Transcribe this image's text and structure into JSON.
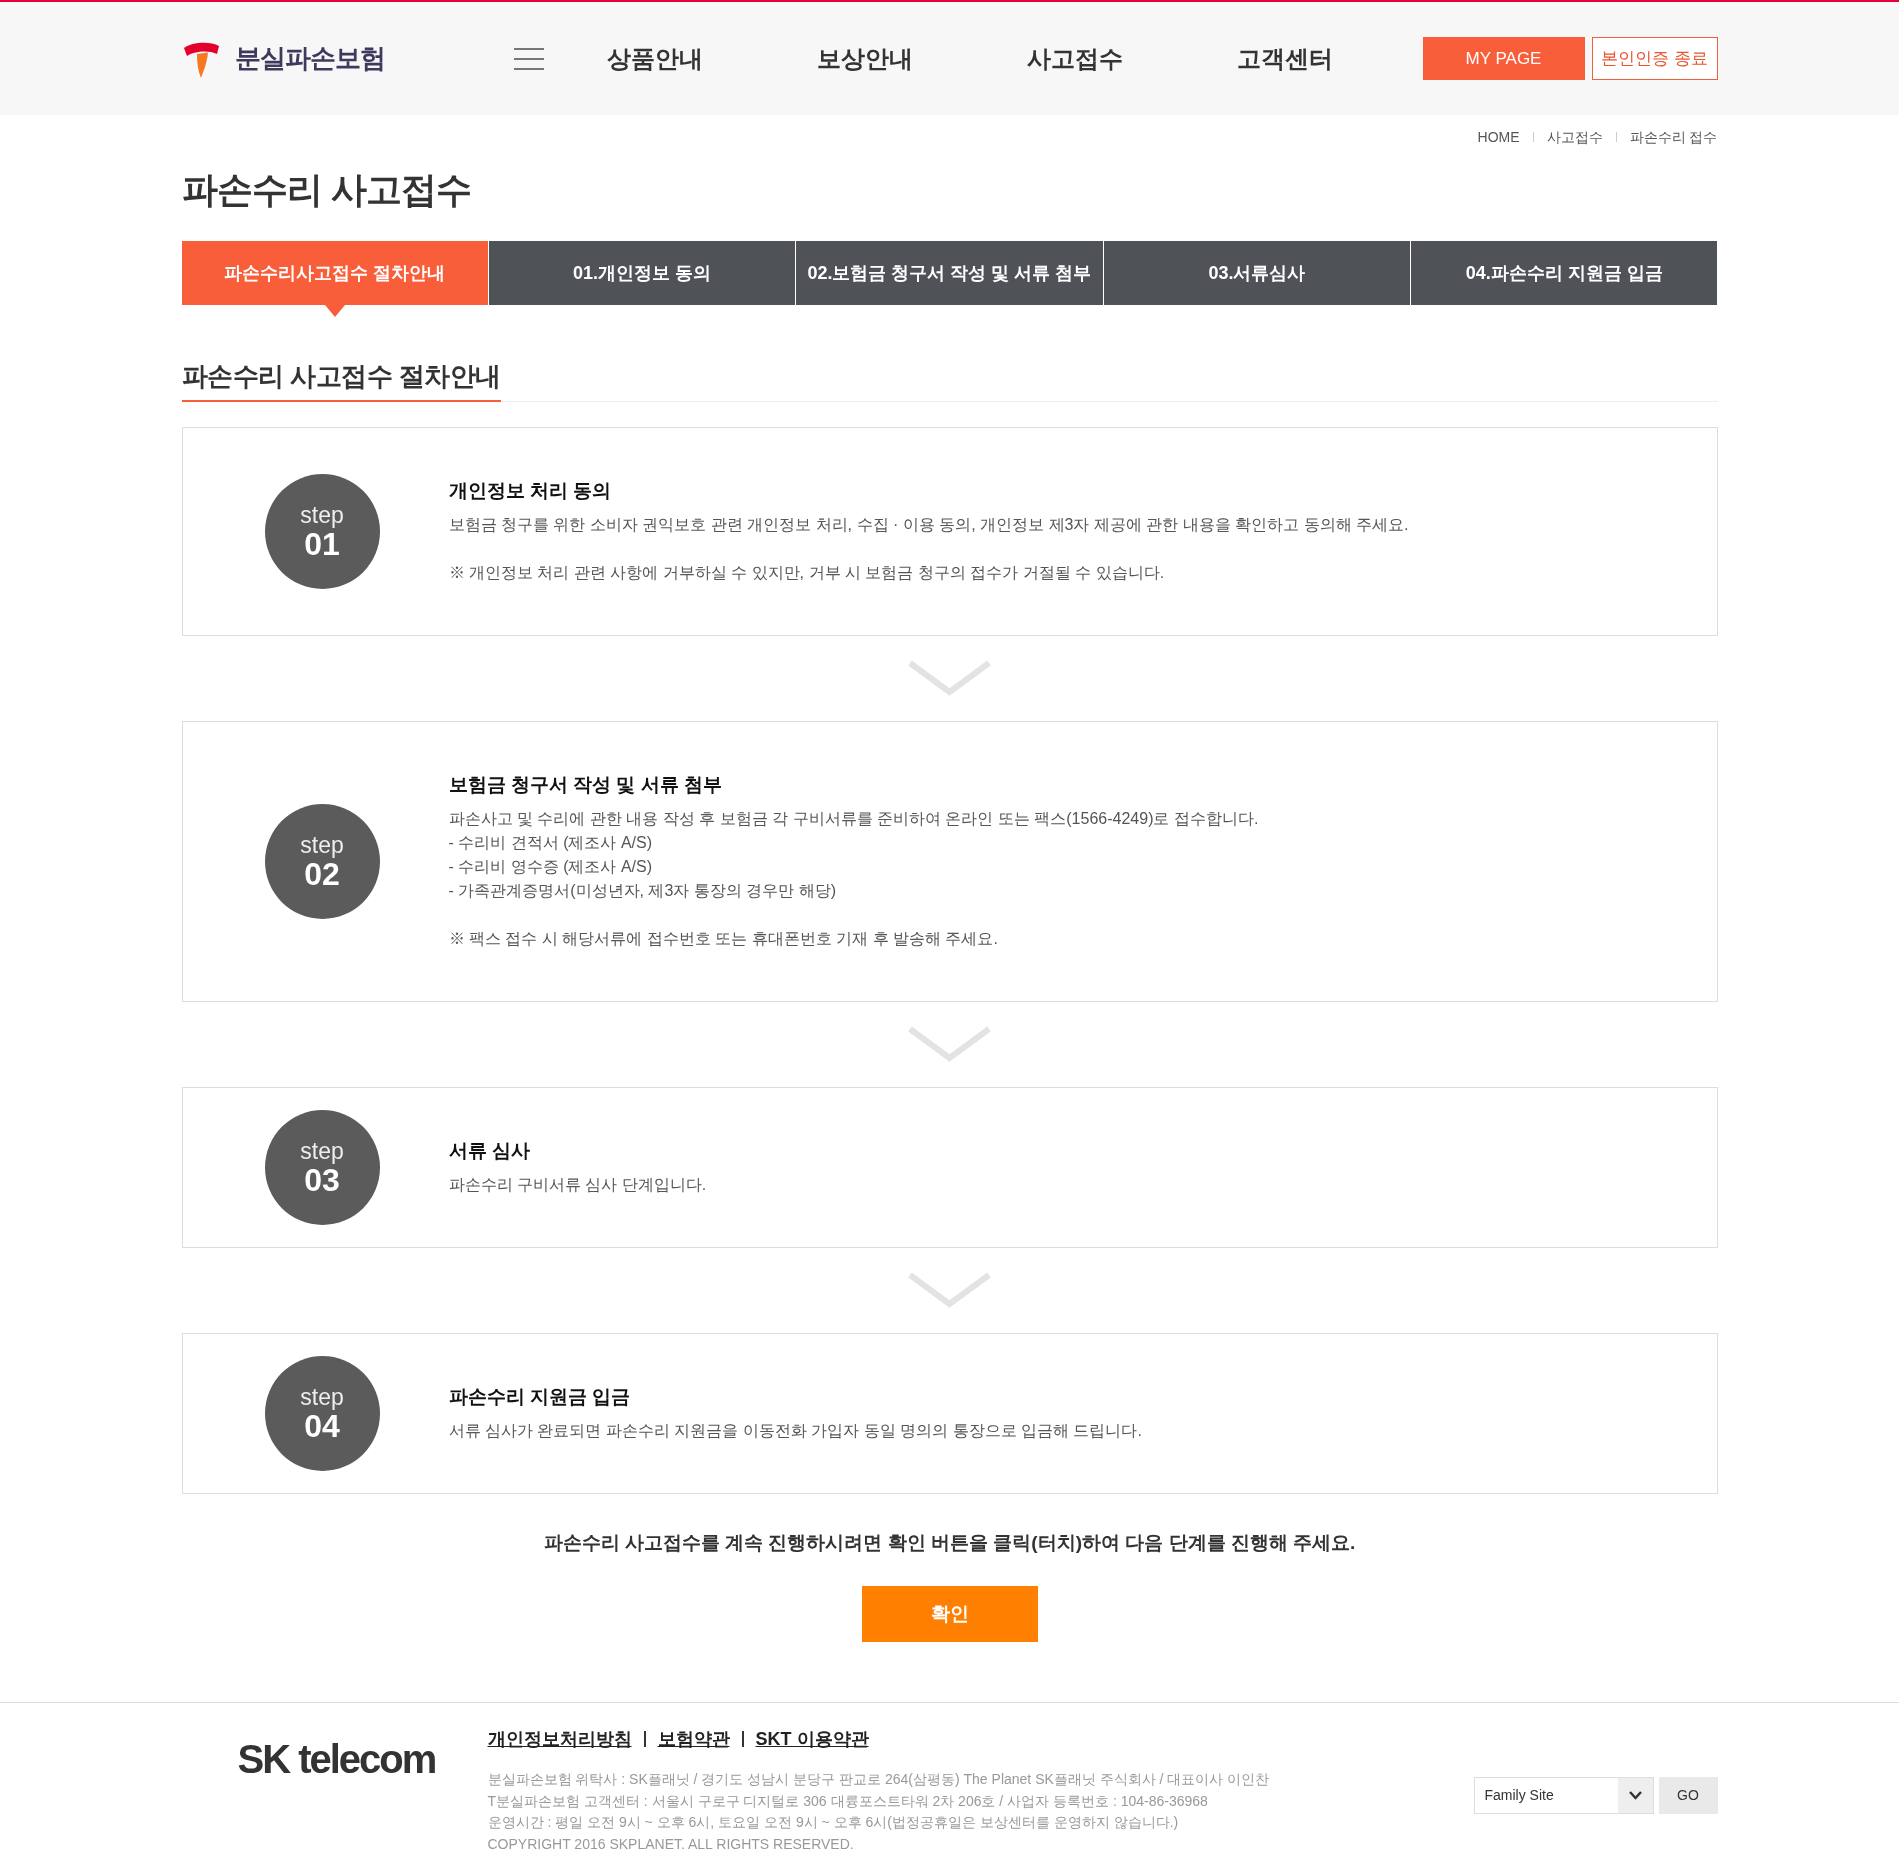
{
  "header": {
    "logo_text": "분실파손보험",
    "nav": [
      "상품안내",
      "보상안내",
      "사고접수",
      "고객센터"
    ],
    "buttons": [
      {
        "label": "MY PAGE",
        "kind": "primary"
      },
      {
        "label": "본인인증 종료",
        "kind": "outline"
      }
    ]
  },
  "breadcrumb": [
    "HOME",
    "사고접수",
    "파손수리 접수"
  ],
  "page_title": "파손수리 사고접수",
  "tabs": [
    {
      "label": "파손수리사고접수 절차안내",
      "selected": true
    },
    {
      "label": "01.개인정보 동의",
      "selected": false
    },
    {
      "label": "02.보험금 청구서 작성 및 서류 첨부",
      "selected": false
    },
    {
      "label": "03.서류심사",
      "selected": false
    },
    {
      "label": "04.파손수리 지원금 입금",
      "selected": false
    }
  ],
  "section_title": "파손수리 사고접수 절차안내",
  "steps": [
    {
      "badge_label": "step",
      "number": "01",
      "title": "개인정보 처리 동의",
      "lines": [
        "보험금 청구를 위한 소비자 권익보호 관련 개인정보 처리, 수집 · 이용 동의, 개인정보 제3자 제공에 관한 내용을 확인하고 동의해 주세요."
      ],
      "note": "※ 개인정보 처리 관련 사항에 거부하실 수 있지만, 거부 시 보험금 청구의 접수가 거절될 수 있습니다."
    },
    {
      "badge_label": "step",
      "number": "02",
      "title": "보험금 청구서 작성 및 서류 첨부",
      "lines": [
        "파손사고 및 수리에 관한 내용 작성 후 보험금 각 구비서류를 준비하여 온라인 또는 팩스(1566-4249)로 접수합니다.",
        "- 수리비 견적서 (제조사 A/S)",
        "- 수리비 영수증 (제조사 A/S)",
        "- 가족관계증명서(미성년자, 제3자 통장의 경우만 해당)"
      ],
      "note": "※ 팩스 접수 시 해당서류에 접수번호 또는 휴대폰번호 기재 후 발송해 주세요."
    },
    {
      "badge_label": "step",
      "number": "03",
      "title": "서류 심사",
      "lines": [
        "파손수리 구비서류 심사 단계입니다."
      ]
    },
    {
      "badge_label": "step",
      "number": "04",
      "title": "파손수리 지원금 입금",
      "lines": [
        "서류 심사가 완료되면 파손수리 지원금을 이동전화 가입자 동일 명의의 통장으로 입금해 드립니다."
      ]
    }
  ],
  "instruction": "파손수리 사고접수를 계속 진행하시려면 확인 버튼을 클릭(터치)하여 다음 단계를 진행해 주세요.",
  "confirm_button": "확인",
  "footer": {
    "logo_text": "SK telecom",
    "links": [
      "개인정보처리방침",
      "보험약관",
      "SKT 이용약관"
    ],
    "info_lines": [
      "분실파손보험 위탁사 : SK플래닛 / 경기도 성남시 분당구 판교로 264(삼평동) The Planet SK플래닛 주식회사 / 대표이사 이인찬",
      "T분실파손보험 고객센터 : 서울시 구로구 디지털로 306 대륭포스트타워 2차 206호 / 사업자 등록번호 : 104-86-36968",
      "운영시간 : 평일 오전 9시 ~ 오후 6시, 토요일 오전 9시 ~ 오후 6시(법정공휴일은 보상센터를 운영하지 않습니다.)",
      "COPYRIGHT 2016 SKPLANET. ALL RIGHTS RESERVED."
    ],
    "family_site": {
      "value": "Family Site"
    },
    "go_button": "GO"
  }
}
